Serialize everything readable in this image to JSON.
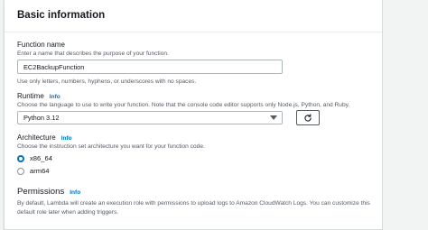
{
  "panel": {
    "title": "Basic information"
  },
  "function_name": {
    "label": "Function name",
    "description": "Enter a name that describes the purpose of your function.",
    "value": "EC2BackupFunction",
    "hint": "Use only letters, numbers, hyphens, or underscores with no spaces."
  },
  "runtime": {
    "label": "Runtime",
    "info": "Info",
    "description": "Choose the language to use to write your function. Note that the console code editor supports only Node.js, Python, and Ruby.",
    "selected": "Python 3.12"
  },
  "architecture": {
    "label": "Architecture",
    "info": "Info",
    "description": "Choose the instruction set architecture you want for your function code.",
    "options": [
      {
        "label": "x86_64",
        "selected": true
      },
      {
        "label": "arm64",
        "selected": false
      }
    ]
  },
  "permissions": {
    "title": "Permissions",
    "info": "Info",
    "description_line1": "By default, Lambda will create an execution role with permissions to upload logs to Amazon CloudWatch Logs. You can customize this",
    "description_line2": "default role later when adding triggers."
  },
  "colors": {
    "accent": "#0073bb",
    "text": "#16191f",
    "muted": "#545b64"
  }
}
